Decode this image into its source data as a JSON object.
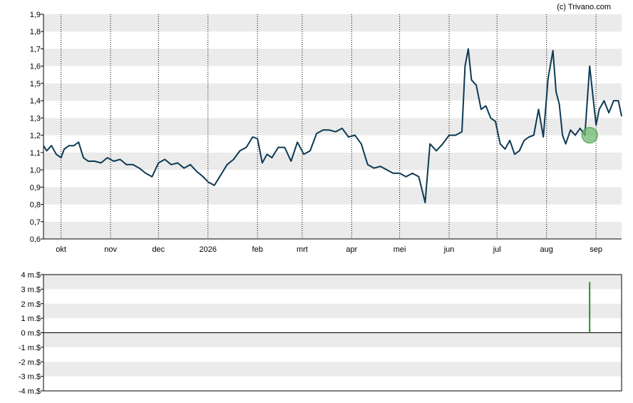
{
  "credit": "(c) Trivano.com",
  "colors": {
    "line": "#0d3a54",
    "band": "#ebebeb",
    "grid": "#000000",
    "marker_fill": "#6fb86f",
    "bar": "#2e8b2e"
  },
  "chart_data": [
    {
      "type": "line",
      "title": "",
      "xlabel": "",
      "ylabel": "",
      "ylim": [
        0.6,
        1.9
      ],
      "y_ticks": [
        "0,6",
        "0,7",
        "0,8",
        "0,9",
        "1,0",
        "1,1",
        "1,2",
        "1,3",
        "1,4",
        "1,5",
        "1,6",
        "1,7",
        "1,8",
        "1,9"
      ],
      "x_ticks": [
        "okt",
        "nov",
        "dec",
        "2026",
        "feb",
        "mrt",
        "apr",
        "mei",
        "jun",
        "jul",
        "aug",
        "sep"
      ],
      "grid": "vertical dotted at month starts, alternating horizontal bands",
      "series": [
        {
          "x": [
            "2025-09-20",
            "2025-09-22",
            "2025-09-25",
            "2025-09-28",
            "2025-10-01",
            "2025-10-03",
            "2025-10-06",
            "2025-10-09",
            "2025-10-12",
            "2025-10-15",
            "2025-10-18",
            "2025-10-22",
            "2025-10-26",
            "2025-10-30",
            "2025-11-03",
            "2025-11-07",
            "2025-11-11",
            "2025-11-15",
            "2025-11-19",
            "2025-11-23",
            "2025-11-27",
            "2025-12-01",
            "2025-12-05",
            "2025-12-09",
            "2025-12-13",
            "2025-12-17",
            "2025-12-21",
            "2025-12-25",
            "2025-12-29",
            "2026-01-01",
            "2026-01-05",
            "2026-01-09",
            "2026-01-13",
            "2026-01-17",
            "2026-01-21",
            "2026-01-25",
            "2026-01-29",
            "2026-02-01",
            "2026-02-04",
            "2026-02-07",
            "2026-02-10",
            "2026-02-14",
            "2026-02-18",
            "2026-02-22",
            "2026-02-26",
            "2026-03-02",
            "2026-03-06",
            "2026-03-10",
            "2026-03-14",
            "2026-03-18",
            "2026-03-22",
            "2026-03-26",
            "2026-03-30",
            "2026-04-03",
            "2026-04-07",
            "2026-04-11",
            "2026-04-15",
            "2026-04-19",
            "2026-04-23",
            "2026-04-27",
            "2026-05-01",
            "2026-05-05",
            "2026-05-09",
            "2026-05-13",
            "2026-05-17",
            "2026-05-20",
            "2026-05-22",
            "2026-05-24",
            "2026-05-28",
            "2026-06-01",
            "2026-06-05",
            "2026-06-09",
            "2026-06-11",
            "2026-06-13",
            "2026-06-15",
            "2026-06-18",
            "2026-06-21",
            "2026-06-24",
            "2026-06-27",
            "2026-06-30",
            "2026-07-03",
            "2026-07-06",
            "2026-07-09",
            "2026-07-12",
            "2026-07-15",
            "2026-07-18",
            "2026-07-21",
            "2026-07-24",
            "2026-07-27",
            "2026-07-30",
            "2026-08-02",
            "2026-08-05",
            "2026-08-07",
            "2026-08-09",
            "2026-08-11",
            "2026-08-13",
            "2026-08-16",
            "2026-08-19",
            "2026-08-22",
            "2026-08-25",
            "2026-08-28",
            "2026-08-30",
            "2026-09-01",
            "2026-09-03",
            "2026-09-06",
            "2026-09-09",
            "2026-09-12",
            "2026-09-15",
            "2026-09-17"
          ],
          "y": [
            1.14,
            1.11,
            1.14,
            1.09,
            1.07,
            1.12,
            1.14,
            1.14,
            1.16,
            1.07,
            1.05,
            1.05,
            1.04,
            1.07,
            1.05,
            1.06,
            1.03,
            1.03,
            1.01,
            0.98,
            0.96,
            1.04,
            1.06,
            1.03,
            1.04,
            1.01,
            1.03,
            0.99,
            0.96,
            0.93,
            0.91,
            0.97,
            1.03,
            1.06,
            1.11,
            1.13,
            1.19,
            1.18,
            1.04,
            1.09,
            1.07,
            1.13,
            1.13,
            1.05,
            1.16,
            1.09,
            1.11,
            1.21,
            1.23,
            1.23,
            1.22,
            1.24,
            1.19,
            1.2,
            1.15,
            1.03,
            1.01,
            1.02,
            1.0,
            0.98,
            0.98,
            0.96,
            0.98,
            0.96,
            0.81,
            1.15,
            1.13,
            1.11,
            1.15,
            1.2,
            1.2,
            1.22,
            1.6,
            1.7,
            1.52,
            1.49,
            1.35,
            1.37,
            1.3,
            1.28,
            1.15,
            1.12,
            1.17,
            1.09,
            1.11,
            1.17,
            1.19,
            1.2,
            1.35,
            1.19,
            1.53,
            1.69,
            1.45,
            1.38,
            1.2,
            1.15,
            1.23,
            1.2,
            1.24,
            1.2,
            1.6,
            1.43,
            1.26,
            1.35,
            1.4,
            1.33,
            1.4,
            1.4,
            1.31
          ]
        }
      ],
      "marker": {
        "x": "2026-08-28",
        "y": 1.2
      }
    },
    {
      "type": "bar",
      "title": "",
      "xlabel": "",
      "ylabel": "",
      "ylim": [
        -4,
        4
      ],
      "y_ticks": [
        "4 m.$",
        "3 m.$",
        "2 m.$",
        "1 m.$",
        "0 m.$",
        "-1 m.$",
        "-2 m.$",
        "-3 m.$",
        "-4 m.$"
      ],
      "grid": "alternating horizontal bands",
      "series": [
        {
          "x": [
            "2026-08-28"
          ],
          "values": [
            3.5
          ]
        }
      ]
    }
  ]
}
